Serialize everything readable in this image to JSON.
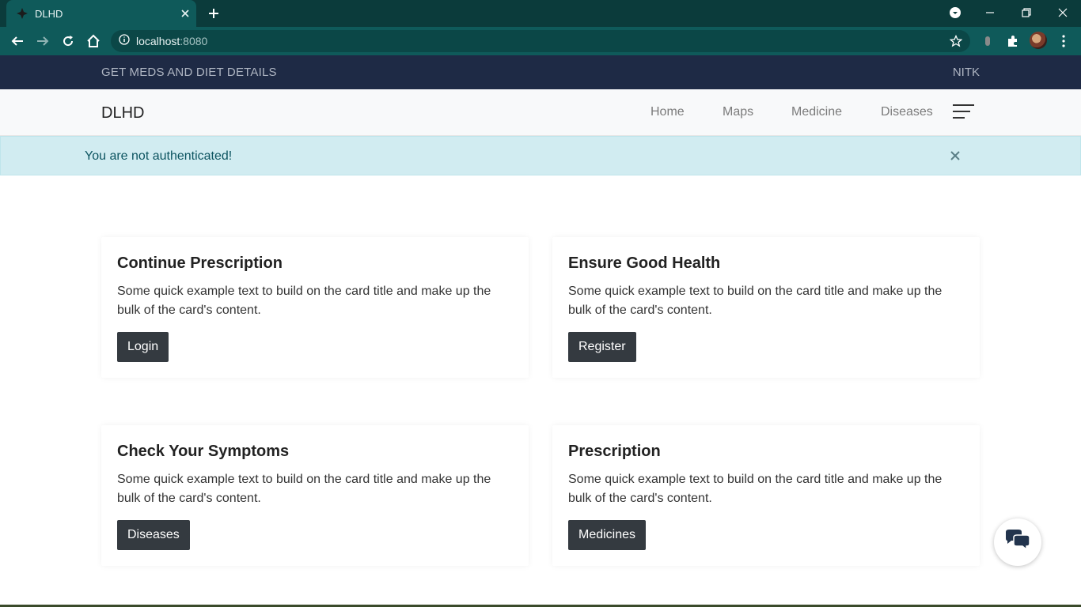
{
  "browser": {
    "tab_title": "DLHD",
    "url_host": "localhost",
    "url_port": ":8080"
  },
  "topbar": {
    "left_text": "GET MEDS AND DIET DETAILS",
    "right_text": "NITK"
  },
  "navbar": {
    "brand": "DLHD",
    "links": [
      "Home",
      "Maps",
      "Medicine",
      "Diseases"
    ]
  },
  "alert": {
    "message": "You are not authenticated!"
  },
  "cards": [
    {
      "title": "Continue Prescription",
      "text": "Some quick example text to build on the card title and make up the bulk of the card's content.",
      "button": "Login"
    },
    {
      "title": "Ensure Good Health",
      "text": "Some quick example text to build on the card title and make up the bulk of the card's content.",
      "button": "Register"
    },
    {
      "title": "Check Your Symptoms",
      "text": "Some quick example text to build on the card title and make up the bulk of the card's content.",
      "button": "Diseases"
    },
    {
      "title": "Prescription",
      "text": "Some quick example text to build on the card title and make up the bulk of the card's content.",
      "button": "Medicines"
    }
  ],
  "icons": {
    "chat": "chat-bubbles-icon",
    "menu": "hamburger-menu-icon",
    "close": "close-icon"
  },
  "colors": {
    "browser_frame": "#0b3b3b",
    "browser_toolbar": "#0f5a5a",
    "topbar": "#1e2a45",
    "alert_bg": "#d1ecf1",
    "alert_text": "#0c5460",
    "button": "#343a40"
  }
}
